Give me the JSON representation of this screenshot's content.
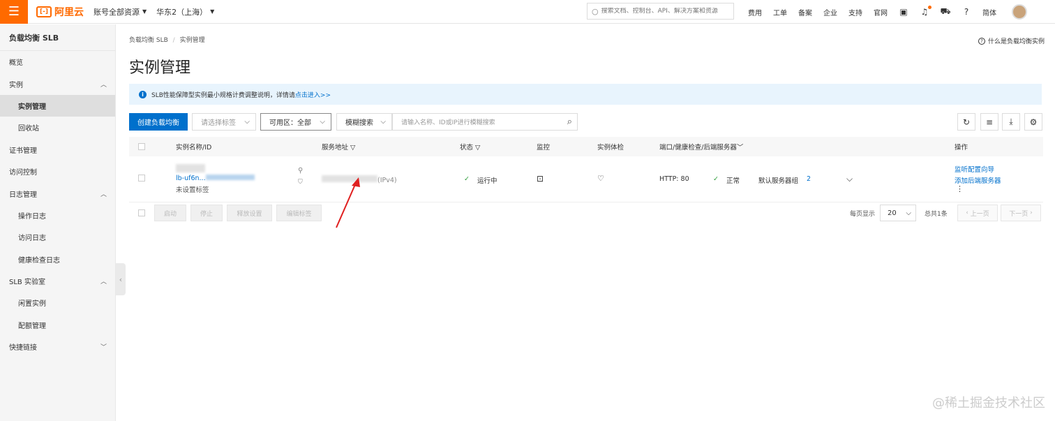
{
  "topbar": {
    "brand": "阿里云",
    "brand_mark": "[-]",
    "account": "账号全部资源",
    "region": "华东2（上海）",
    "search_placeholder": "搜索文档、控制台、API、解决方案和资源",
    "links": [
      "费用",
      "工单",
      "备案",
      "企业",
      "支持",
      "官网"
    ],
    "lang": "简体"
  },
  "sidebar": {
    "title": "负载均衡 SLB",
    "items": [
      {
        "label": "概览"
      },
      {
        "label": "实例"
      },
      {
        "label": "实例管理"
      },
      {
        "label": "回收站"
      },
      {
        "label": "证书管理"
      },
      {
        "label": "访问控制"
      },
      {
        "label": "日志管理"
      },
      {
        "label": "操作日志"
      },
      {
        "label": "访问日志"
      },
      {
        "label": "健康检查日志"
      },
      {
        "label": "SLB 实验室"
      },
      {
        "label": "闲置实例"
      },
      {
        "label": "配额管理"
      },
      {
        "label": "快捷链接"
      }
    ]
  },
  "main": {
    "breadcrumb": [
      "负载均衡 SLB",
      "/",
      "实例管理"
    ],
    "help_link": "什么是负载均衡实例",
    "title": "实例管理",
    "notice": {
      "text": "SLB性能保障型实例最小规格计费调整说明，详情请",
      "link": "点击进入>>"
    },
    "toolbar": {
      "create_label": "创建负载均衡",
      "tag_select": "请选择标签",
      "zone_select": "可用区：全部",
      "search_mode": "模糊搜索",
      "search_placeholder": "请输入名称、ID或IP进行模糊搜索"
    },
    "table": {
      "headers": [
        "实例名称/ID",
        "服务地址",
        "状态",
        "监控",
        "实例体检",
        "端口/健康检查/后端服务器",
        "操作"
      ],
      "rows": [
        {
          "id_fragment": "lb-uf6n...",
          "tag": "未设置标签",
          "ip_type": "(IPv4)",
          "status": "运行中",
          "port": "HTTP:  80",
          "health": "正常",
          "server_group": "默认服务器组",
          "server_count": "2",
          "actions": [
            "监听配置向导",
            "添加后端服务器"
          ]
        }
      ]
    },
    "bulk_actions": [
      "启动",
      "停止",
      "释放设置",
      "编辑标签"
    ],
    "pager": {
      "per_page_label": "每页显示",
      "per_page": "20",
      "total": "总共1条",
      "prev": "上一页",
      "next": "下一页"
    }
  },
  "watermark": "@稀土掘金技术社区"
}
